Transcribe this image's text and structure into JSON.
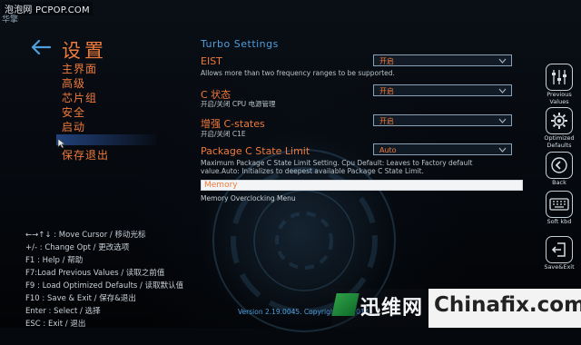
{
  "watermark_top": "泡泡网 PCPOP.COM",
  "brand_logo": "华擎",
  "nav": {
    "section_title": "设置",
    "items": [
      "主界面",
      "高级",
      "芯片组",
      "安全",
      "启动"
    ],
    "save_exit": "保存退出"
  },
  "help": [
    "←→↑↓ : Move Cursor / 移动光标",
    "+/- : Change Opt / 更改选项",
    "F1 : Help / 帮助",
    "F7:Load Previous Values / 读取之前值",
    "F9 : Load Optimized Defaults / 读取默认值",
    "F10 : Save & Exit / 保存&退出",
    "Enter : Select / 选择",
    "ESC : Exit / 退出"
  ],
  "panel": {
    "title": "Turbo Settings",
    "settings": [
      {
        "name": "EIST",
        "desc": "Allows more than two frequency ranges to be supported.",
        "value": "开启"
      },
      {
        "name": "C 状态",
        "desc": "开启/关闭 CPU 电源管理",
        "value": "开启"
      },
      {
        "name": "增强 C-states",
        "desc": "开启/关闭  C1E",
        "value": "开启"
      },
      {
        "name": "Package C State Limit",
        "desc": "Maximum Package C State Limit Setting. Cpu Default: Leaves to Factory default",
        "desc2": "value.Auto: Initializes to deepest available Package C State Limit.",
        "value": "Auto"
      }
    ],
    "memory_label": "Memory",
    "memory_desc": "Memory Overclocking Menu"
  },
  "version": "Version 2.19.0045. Copyright (C) 2014",
  "sidebar": {
    "previous": [
      "Previous",
      "Values"
    ],
    "optimized": [
      "Optimized",
      "Defaults"
    ],
    "back": "Back",
    "softkbd": "Soft kbd",
    "save_exit": "Save&Exit"
  },
  "watermark_bottom": {
    "left": "迅维网",
    "right": "Chinafix.com"
  },
  "colors": {
    "accent_orange": "#f07a3b",
    "accent_blue": "#4f9fdc",
    "background": "#05080d"
  }
}
